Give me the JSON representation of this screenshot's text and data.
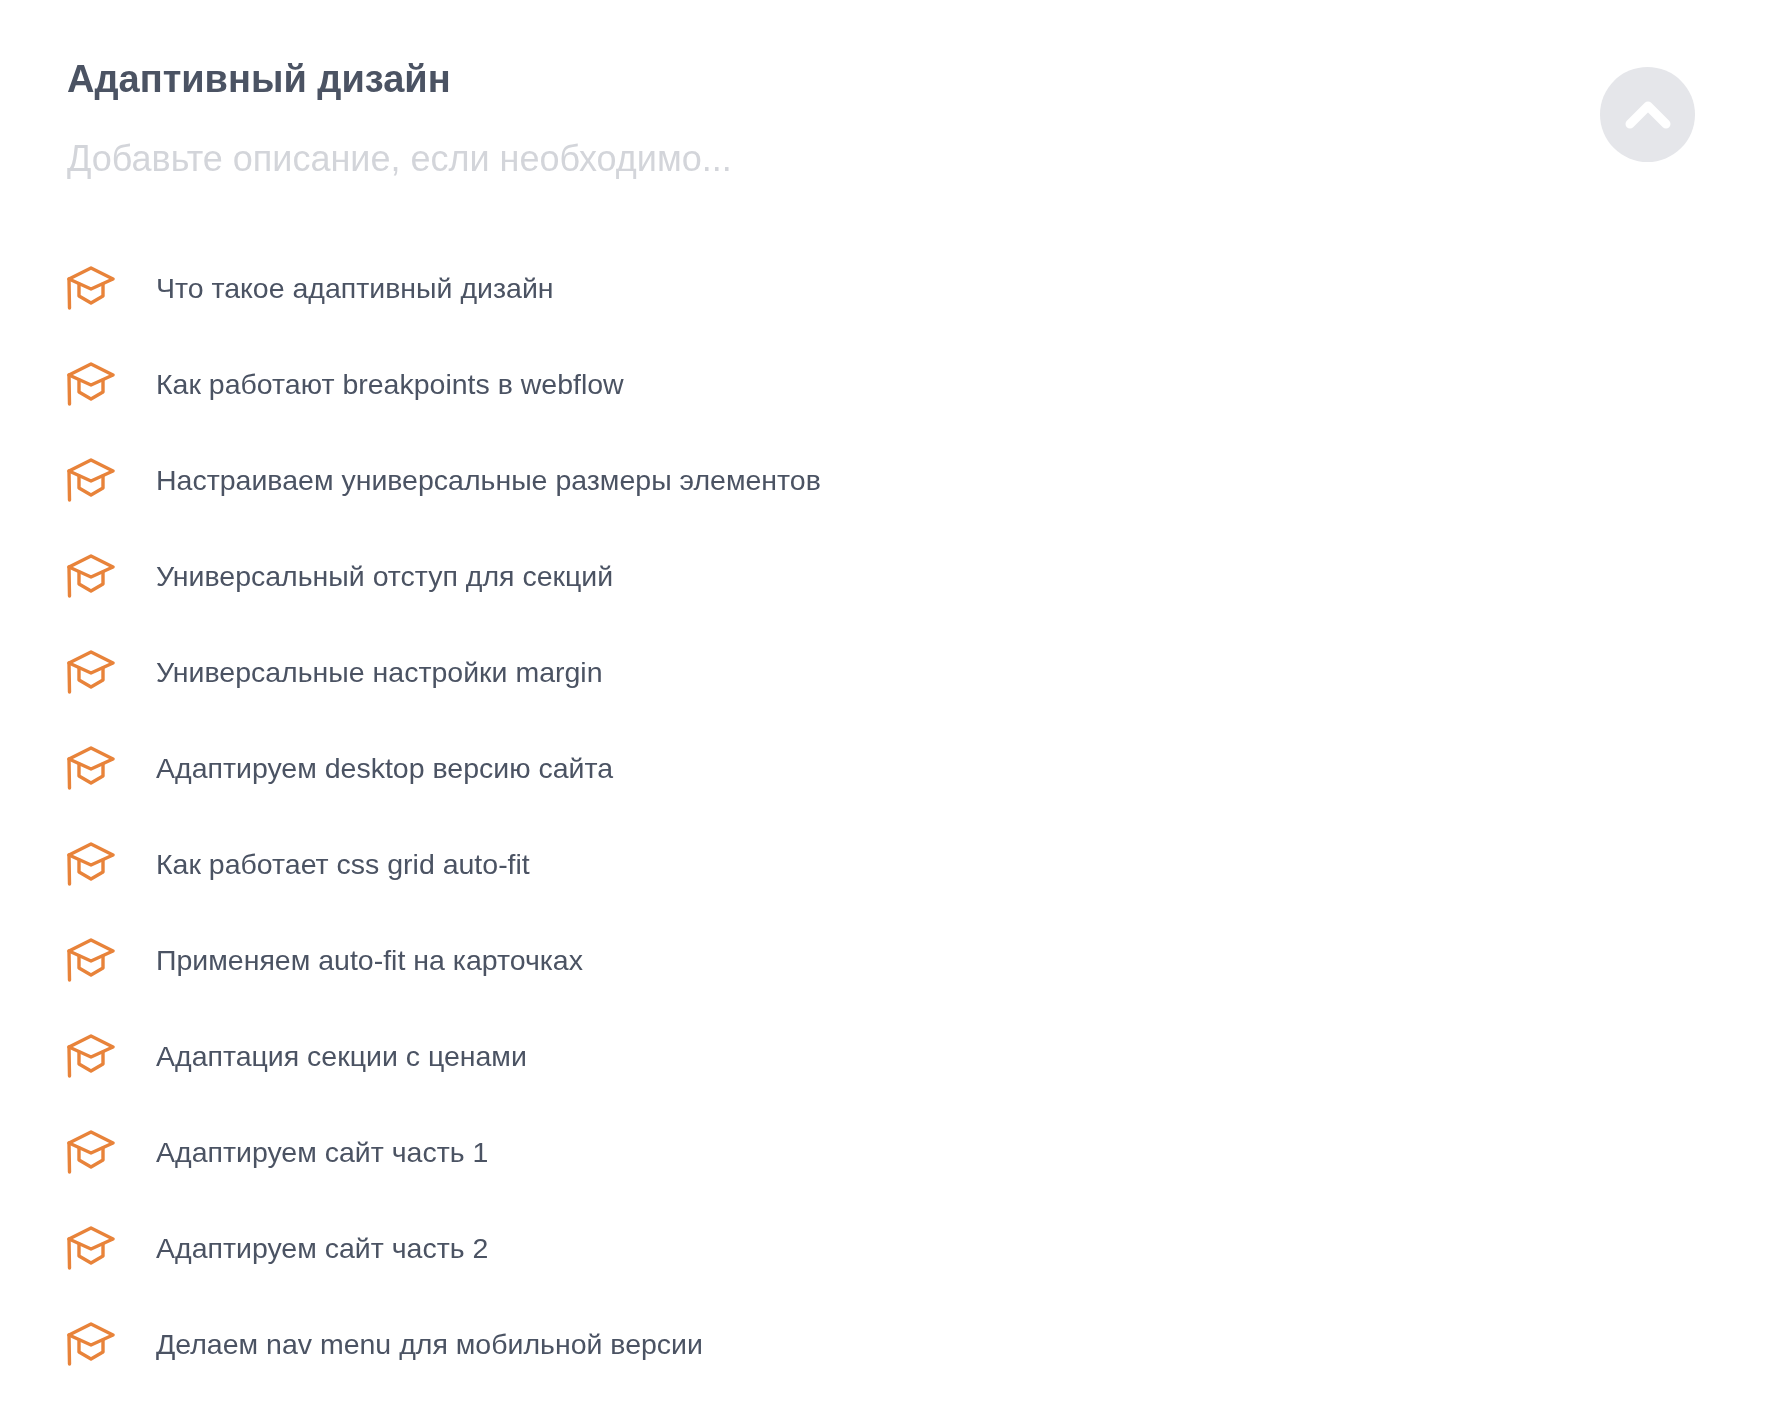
{
  "section": {
    "title": "Адаптивный дизайн",
    "description": {
      "placeholder": "Добавьте описание, если необходимо..."
    }
  },
  "lessons": [
    {
      "title": "Что такое адаптивный дизайн"
    },
    {
      "title": "Как работают breakpoints в webflow"
    },
    {
      "title": "Настраиваем универсальные размеры элементов"
    },
    {
      "title": "Универсальный отступ для секций"
    },
    {
      "title": "Универсальные настройки margin"
    },
    {
      "title": "Адаптируем desktop версию сайта"
    },
    {
      "title": "Как работает css grid auto-fit"
    },
    {
      "title": "Применяем auto-fit на карточках"
    },
    {
      "title": "Адаптация секции с ценами"
    },
    {
      "title": "Адаптируем сайт часть 1"
    },
    {
      "title": "Адаптируем сайт часть 2"
    },
    {
      "title": "Делаем nav menu для мобильной версии"
    }
  ]
}
